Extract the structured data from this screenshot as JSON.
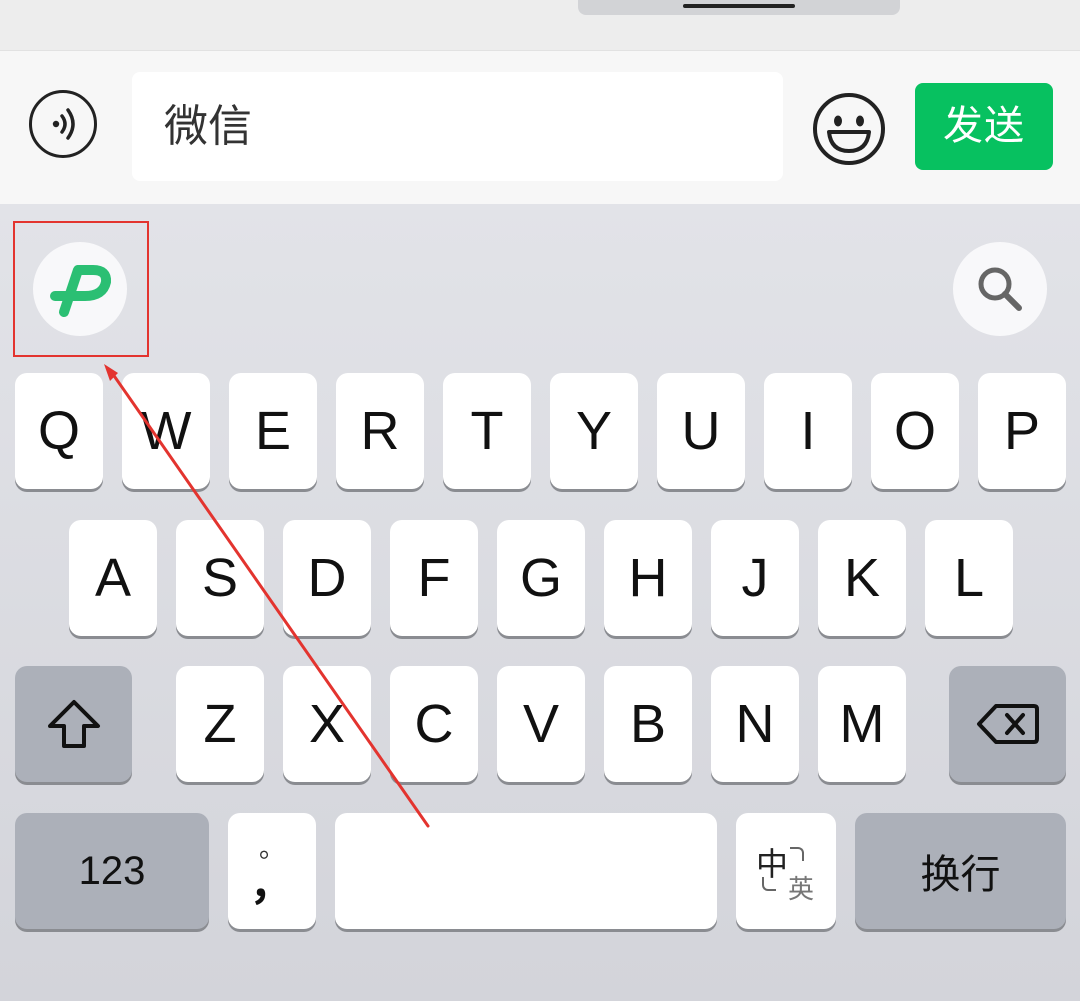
{
  "input_bar": {
    "text_value": "微信",
    "send_label": "发送",
    "voice_icon": "voice-wave-icon",
    "emoji_icon": "smiley-icon"
  },
  "toolbar": {
    "app_icon": "p-logo-icon",
    "search_icon": "search-icon"
  },
  "keyboard": {
    "row1": [
      "Q",
      "W",
      "E",
      "R",
      "T",
      "Y",
      "U",
      "I",
      "O",
      "P"
    ],
    "row2": [
      "A",
      "S",
      "D",
      "F",
      "G",
      "H",
      "J",
      "K",
      "L"
    ],
    "row3": [
      "Z",
      "X",
      "C",
      "V",
      "B",
      "N",
      "M"
    ],
    "shift_icon": "shift-icon",
    "delete_icon": "delete-icon",
    "numbers_label": "123",
    "punct_top": "。",
    "punct_bottom": "，",
    "space_label": "",
    "lang_main": "中",
    "lang_sub": "英",
    "return_label": "换行"
  },
  "colors": {
    "send_green": "#07c160",
    "logo_green": "#2bbf73",
    "annotation_red": "#e3342f"
  }
}
